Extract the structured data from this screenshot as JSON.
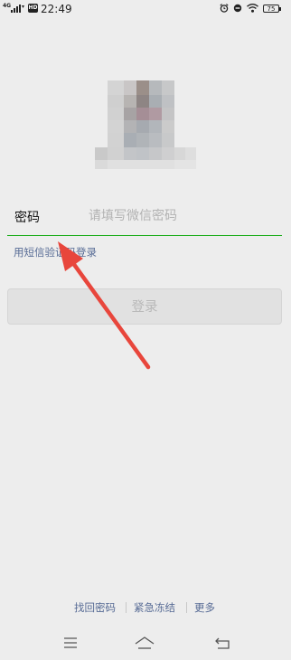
{
  "status_bar": {
    "network": "4G",
    "hd_badge": "HD",
    "time": "22:49",
    "battery": "75"
  },
  "form": {
    "password_label": "密码",
    "password_placeholder": "请填写微信密码",
    "sms_login_link": "用短信验证码登录",
    "login_button": "登录"
  },
  "bottom_links": {
    "recover_password": "找回密码",
    "emergency_freeze": "紧急冻结",
    "more": "更多"
  },
  "colors": {
    "accent_green": "#1aad19",
    "link_blue": "#576b95",
    "arrow_red": "#e8463c"
  },
  "icons": {
    "nav_menu": "menu-icon",
    "nav_home": "home-icon",
    "nav_back": "back-icon"
  }
}
